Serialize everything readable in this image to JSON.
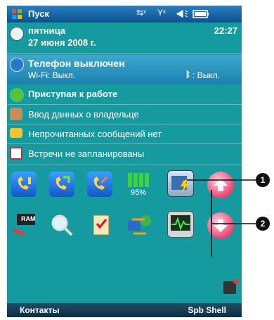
{
  "titlebar": {
    "title": "Пуск"
  },
  "today": {
    "date_day": "пятница",
    "date_full": "27 июня 2008 г.",
    "time": "22:27",
    "phone_title": "Телефон выключен",
    "wifi_status": "Wi-Fi: Выкл.",
    "bt_status": ": Выкл.",
    "getting_started": "Приступая к работе",
    "owner_info": "Ввод данных о владельце",
    "messages": "Непрочитанных сообщений нет",
    "appointments": "Встречи не запланированы"
  },
  "grid": {
    "battery_percent": "95%",
    "ram_label": "RAM"
  },
  "softkeys": {
    "left": "Контакты",
    "right": "Spb Shell"
  },
  "callouts": {
    "one": "1",
    "two": "2"
  },
  "colors": {
    "screen_bg": "#159aa0",
    "selected_row": "#2a95c2",
    "arrow_button": "#e8456f"
  }
}
